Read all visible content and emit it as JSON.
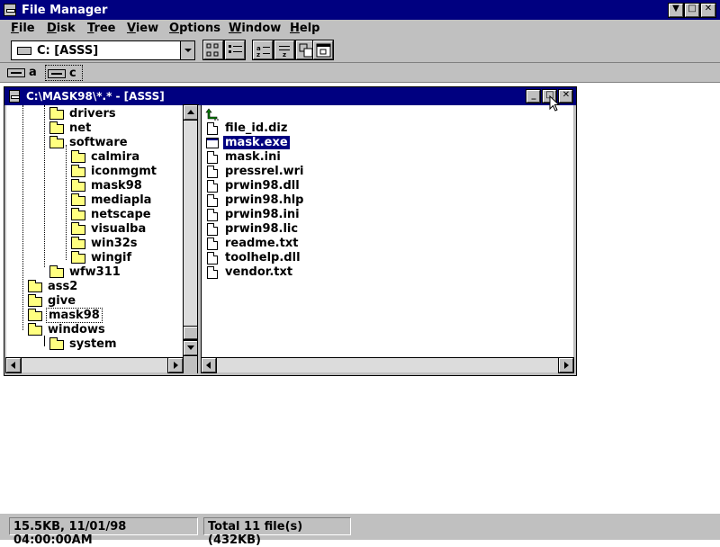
{
  "app": {
    "title": "File Manager"
  },
  "menu": [
    "File",
    "Disk",
    "Tree",
    "View",
    "Options",
    "Window",
    "Help"
  ],
  "toolbar": {
    "drive_selected": "C: [ASSS]"
  },
  "drives": [
    {
      "letter": "a",
      "selected": false
    },
    {
      "letter": "c",
      "selected": true
    }
  ],
  "child_window": {
    "title": "C:\\MASK98\\*.* - [ASSS]"
  },
  "tree": [
    {
      "name": "drivers",
      "level": 2
    },
    {
      "name": "net",
      "level": 2
    },
    {
      "name": "software",
      "level": 2
    },
    {
      "name": "calmira",
      "level": 3
    },
    {
      "name": "iconmgmt",
      "level": 3
    },
    {
      "name": "mask98",
      "level": 3
    },
    {
      "name": "mediapla",
      "level": 3
    },
    {
      "name": "netscape",
      "level": 3
    },
    {
      "name": "visualba",
      "level": 3
    },
    {
      "name": "win32s",
      "level": 3
    },
    {
      "name": "wingif",
      "level": 3
    },
    {
      "name": "wfw311",
      "level": 2
    },
    {
      "name": "ass2",
      "level": 1
    },
    {
      "name": "give",
      "level": 1
    },
    {
      "name": "mask98",
      "level": 1,
      "selected": true
    },
    {
      "name": "windows",
      "level": 1
    },
    {
      "name": "system",
      "level": 2
    }
  ],
  "files": [
    {
      "name": "..",
      "type": "up"
    },
    {
      "name": "file_id.diz",
      "type": "doc"
    },
    {
      "name": "mask.exe",
      "type": "exe",
      "selected": true
    },
    {
      "name": "mask.ini",
      "type": "doc"
    },
    {
      "name": "pressrel.wri",
      "type": "doc"
    },
    {
      "name": "prwin98.dll",
      "type": "doc"
    },
    {
      "name": "prwin98.hlp",
      "type": "doc"
    },
    {
      "name": "prwin98.ini",
      "type": "doc"
    },
    {
      "name": "prwin98.lic",
      "type": "doc"
    },
    {
      "name": "readme.txt",
      "type": "doc"
    },
    {
      "name": "toolhelp.dll",
      "type": "doc"
    },
    {
      "name": "vendor.txt",
      "type": "doc"
    }
  ],
  "status": {
    "left": "15.5KB, 11/01/98 04:00:00AM",
    "right": "Total 11 file(s) (432KB)"
  },
  "colors": {
    "titlebar": "#000080",
    "face": "#c0c0c0",
    "folder": "#ffff80",
    "selection": "#000080"
  }
}
